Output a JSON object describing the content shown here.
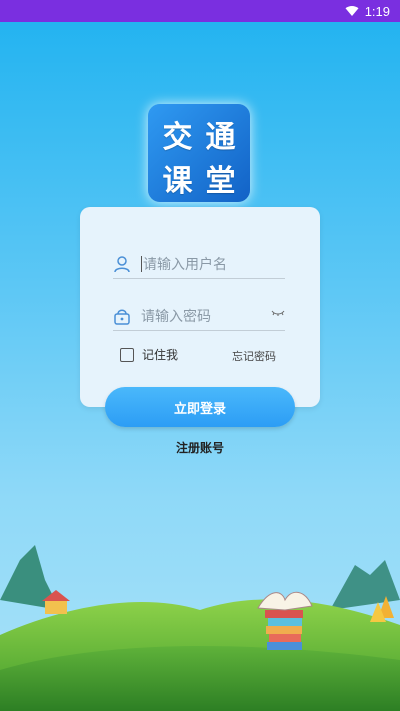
{
  "status_bar": {
    "time": "1:19",
    "icon": "wifi-icon"
  },
  "logo": {
    "chars": [
      "交",
      "通",
      "课",
      "堂"
    ]
  },
  "login_form": {
    "username_placeholder": "请输入用户名",
    "password_placeholder": "请输入密码",
    "remember_label": "记住我",
    "forgot_label": "忘记密码"
  },
  "login_button": "立即登录",
  "register_link": "注册账号",
  "colors": {
    "status_bar": "#7a2fe0",
    "background_top": "#1fb2f0",
    "button": "#2c9df5"
  }
}
